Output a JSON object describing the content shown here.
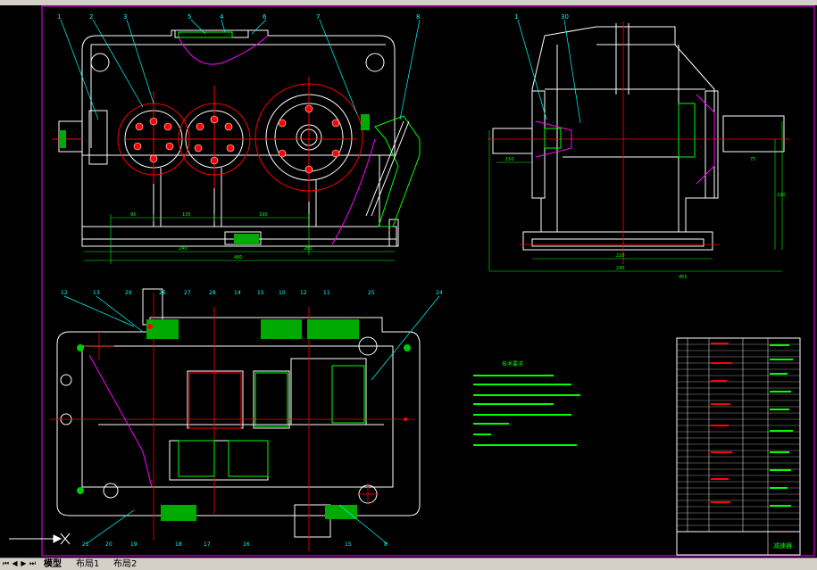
{
  "tabs": {
    "model": "模型",
    "layout1": "布局1",
    "layout2": "布局2"
  },
  "front_view": {
    "balloons": [
      "1",
      "2",
      "3",
      "5",
      "4",
      "6",
      "7",
      "8"
    ],
    "dim_bottom": [
      "240",
      "280"
    ],
    "dim_center": [
      "95",
      "135",
      "190"
    ],
    "dim_total": "480"
  },
  "side_view": {
    "balloons": [
      "1",
      "30"
    ],
    "dim_bottom": [
      "220",
      "240",
      "455"
    ],
    "dim_right": [
      "75",
      "220"
    ],
    "dim_left": "150"
  },
  "top_view": {
    "balloons_top": [
      "12",
      "13",
      "29",
      "26",
      "27",
      "28",
      "14",
      "15",
      "10",
      "12",
      "11",
      "25",
      "24"
    ],
    "balloons_bottom": [
      "21",
      "20",
      "19",
      "18",
      "17",
      "16",
      "15",
      "8"
    ]
  },
  "tech_notes_title": "技术要求",
  "title_block": {
    "heading": "减速器"
  }
}
